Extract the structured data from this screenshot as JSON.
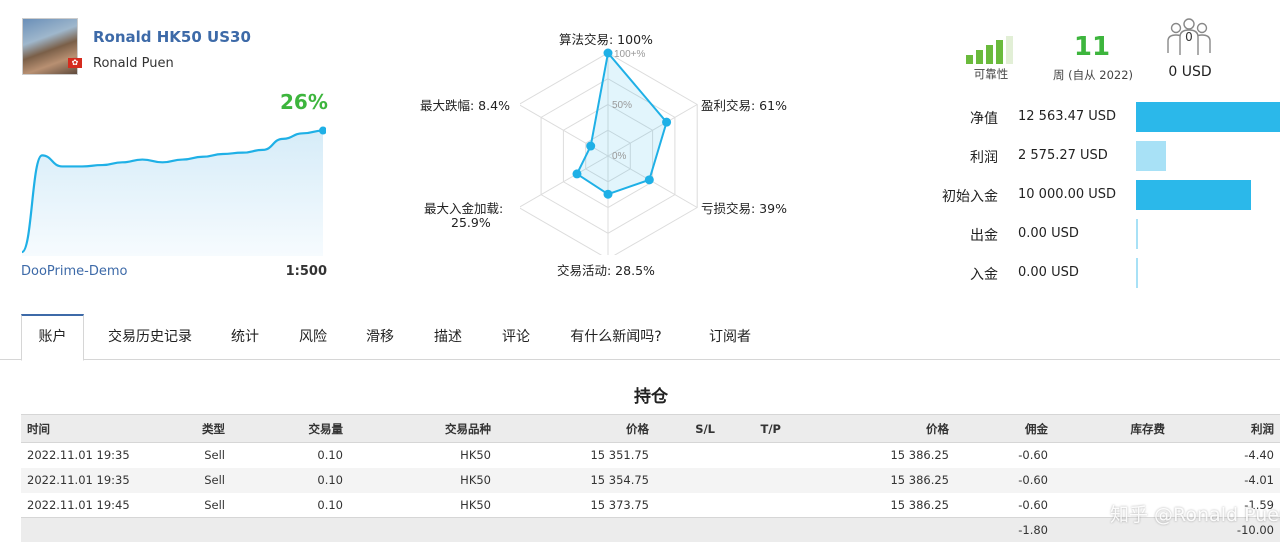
{
  "signal": {
    "title": "Ronald HK50 US30",
    "author": "Ronald Puen",
    "growth": "26%",
    "broker": "DooPrime-Demo",
    "leverage": "1:500",
    "growth_curve": [
      0,
      70,
      62,
      62,
      63,
      65,
      67,
      65,
      67,
      69,
      71,
      72,
      74,
      82,
      86,
      88
    ]
  },
  "radar": {
    "labels": {
      "algo": "算法交易: 100%",
      "profit": "盈利交易: 61%",
      "loss": "亏损交易: 39%",
      "activity": "交易活动: 28.5%",
      "deposit_load_line1": "最大入金加载:",
      "deposit_load_line2": "25.9%",
      "drawdown": "最大跌幅: 8.4%"
    },
    "scale": {
      "top": "100+%",
      "mid": "50%",
      "zero": "0%"
    },
    "values": [
      100,
      61,
      39,
      28.5,
      25.9,
      8.4
    ]
  },
  "stats": {
    "reliability_label": "可靠性",
    "reliability_bars": 4,
    "weeks": "11",
    "weeks_label": "周 (自从 2022)",
    "subscribers_count": "0",
    "subscribers_value": "0 USD"
  },
  "financials": [
    {
      "label": "净值",
      "value": "12 563.47 USD",
      "fraction": 1.0,
      "color": "#2bb8ea"
    },
    {
      "label": "利润",
      "value": "2 575.27 USD",
      "fraction": 0.205,
      "color": "#a8e1f6"
    },
    {
      "label": "初始入金",
      "value": "10 000.00 USD",
      "fraction": 0.796,
      "color": "#2bb8ea"
    },
    {
      "label": "出金",
      "value": "0.00 USD",
      "fraction": 0.0,
      "color": "#a8e1f6"
    },
    {
      "label": "入金",
      "value": "0.00 USD",
      "fraction": 0.0,
      "color": "#a8e1f6"
    }
  ],
  "tabs": [
    "账户",
    "交易历史记录",
    "统计",
    "风险",
    "滑移",
    "描述",
    "评论",
    "有什么新闻吗?",
    "订阅者"
  ],
  "active_tab": 0,
  "section_title": "持仓",
  "table": {
    "headers": [
      "时间",
      "类型",
      "交易量",
      "交易品种",
      "价格",
      "S/L",
      "T/P",
      "价格",
      "佣金",
      "库存费",
      "利润"
    ],
    "rows": [
      [
        "2022.11.01 19:35",
        "Sell",
        "0.10",
        "HK50",
        "15 351.75",
        "",
        "",
        "15 386.25",
        "-0.60",
        "",
        "-4.40"
      ],
      [
        "2022.11.01 19:35",
        "Sell",
        "0.10",
        "HK50",
        "15 354.75",
        "",
        "",
        "15 386.25",
        "-0.60",
        "",
        "-4.01"
      ],
      [
        "2022.11.01 19:45",
        "Sell",
        "0.10",
        "HK50",
        "15 373.75",
        "",
        "",
        "15 386.25",
        "-0.60",
        "",
        "-1.59"
      ]
    ],
    "totals": {
      "commission": "-1.80",
      "profit": "-10.00"
    }
  },
  "watermark": "知乎 @Ronald Puen",
  "colors": {
    "accent": "#3d6aa8",
    "growth": "#3db53d",
    "chart": "#1fb0e6",
    "negative": "#c0282d"
  }
}
